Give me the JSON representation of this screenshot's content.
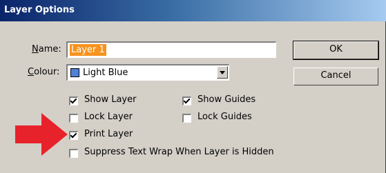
{
  "window": {
    "title": "Layer Options"
  },
  "form": {
    "name_label_accel": "N",
    "name_label_rest": "ame:",
    "name_value": "Layer 1",
    "colour_label_accel": "C",
    "colour_label_rest": "olour:",
    "colour_value": "Light Blue",
    "colour_swatch_hex": "#4f81d8"
  },
  "buttons": {
    "ok": "OK",
    "cancel": "Cancel"
  },
  "options": {
    "show_layer": {
      "label": "Show Layer",
      "checked": true
    },
    "show_guides": {
      "label": "Show Guides",
      "checked": true
    },
    "lock_layer": {
      "label": "Lock Layer",
      "checked": false
    },
    "lock_guides": {
      "label": "Lock Guides",
      "checked": false
    },
    "print_layer": {
      "label": "Print Layer",
      "checked": true
    },
    "suppress_text_wrap": {
      "label": "Suppress Text Wrap When Layer is Hidden",
      "checked": false
    }
  },
  "annotation": {
    "arrow_color": "#e8222a"
  }
}
